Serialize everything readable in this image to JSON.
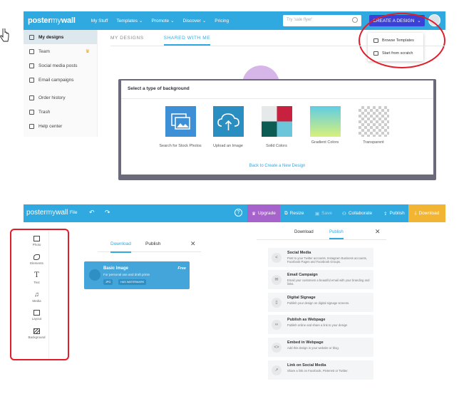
{
  "top_nav": {
    "logo_a": "poster",
    "logo_b": "my",
    "logo_c": "wall",
    "items": [
      {
        "label": "My Stuff",
        "caret": false
      },
      {
        "label": "Templates",
        "caret": true
      },
      {
        "label": "Promote",
        "caret": true
      },
      {
        "label": "Discover",
        "caret": true
      },
      {
        "label": "Pricing",
        "caret": false
      }
    ],
    "search_placeholder": "Try 'sale flyer'",
    "create_label": "CREATE A DESIGN",
    "brand_color": "#2fa9e0",
    "create_color": "#3a40d8"
  },
  "dropdown": {
    "items": [
      {
        "label": "Browse Templates",
        "icon": "copy-icon"
      },
      {
        "label": "Start from scratch",
        "icon": "monitor-icon"
      }
    ]
  },
  "sidebar": {
    "items": [
      {
        "label": "My designs",
        "icon": "designs-icon",
        "active": true
      },
      {
        "label": "Team",
        "icon": "team-icon",
        "crown": true
      },
      {
        "label": "Social media posts",
        "icon": "send-icon"
      },
      {
        "label": "Email campaigns",
        "icon": "email-icon"
      },
      {
        "label": "Order history",
        "icon": "history-icon"
      },
      {
        "label": "Trash",
        "icon": "trash-icon"
      },
      {
        "label": "Help center",
        "icon": "help-icon"
      }
    ]
  },
  "tabs": [
    {
      "label": "MY DESIGNS",
      "active": false
    },
    {
      "label": "SHARED WITH ME",
      "active": true
    }
  ],
  "modal": {
    "title": "Select a type of background",
    "options": [
      {
        "label": "Search for Stock Photos",
        "icon": "photos-icon"
      },
      {
        "label": "Upload an Image",
        "icon": "upload-cloud-icon"
      },
      {
        "label": "Solid Colors",
        "icon": "solid-colors-icon"
      },
      {
        "label": "Gradient Colors",
        "icon": "gradient-icon"
      },
      {
        "label": "Transparent",
        "icon": "transparent-icon"
      }
    ],
    "back_link": "Back to Create a New Design"
  },
  "editor_bar": {
    "logo_a": "poster",
    "logo_b": "my",
    "logo_c": "wall",
    "file_label": "File",
    "upgrade_label": "Upgrade",
    "resize_label": "Resize",
    "save_label": "Save",
    "collaborate_label": "Collaborate",
    "publish_label": "Publish",
    "download_label": "Download",
    "upgrade_color": "#a663cc",
    "download_color": "#f2b533"
  },
  "tools": [
    {
      "label": "Photo",
      "icon": "photo-icon"
    },
    {
      "label": "Elements",
      "icon": "shapes-icon"
    },
    {
      "label": "Text",
      "icon": "text-icon"
    },
    {
      "label": "Media",
      "icon": "music-icon"
    },
    {
      "label": "Layout",
      "icon": "layout-icon"
    },
    {
      "label": "Background",
      "icon": "background-icon"
    }
  ],
  "download_panel": {
    "tab_download": "Download",
    "tab_publish": "Publish",
    "basic_title": "Basic Image",
    "basic_sub": "For personal use and draft prints",
    "basic_free": "Free",
    "chip1": "JPG",
    "chip2": "HAS WATERMARK"
  },
  "publish_panel": {
    "tab_download": "Download",
    "tab_publish": "Publish",
    "items": [
      {
        "title": "Social Media",
        "desc": "Post to your Twitter accounts, Instagram Business accounts, Facebook Pages and Facebook Groups.",
        "icon": "share-icon"
      },
      {
        "title": "Email Campaign",
        "desc": "Email your customers a beautiful email with your branding and links.",
        "icon": "mail-icon"
      },
      {
        "title": "Digital Signage",
        "desc": "Publish your design on digital signage screens.",
        "icon": "signage-icon"
      },
      {
        "title": "Publish as Webpage",
        "desc": "Publish online and share a link to your design",
        "icon": "link-icon"
      },
      {
        "title": "Embed in Webpage",
        "desc": "Add this design in your website or blog.",
        "icon": "code-icon"
      },
      {
        "title": "Link on Social Media",
        "desc": "Share a link on Facebook, Pinterest or Twitter.",
        "icon": "share-link-icon"
      }
    ]
  }
}
